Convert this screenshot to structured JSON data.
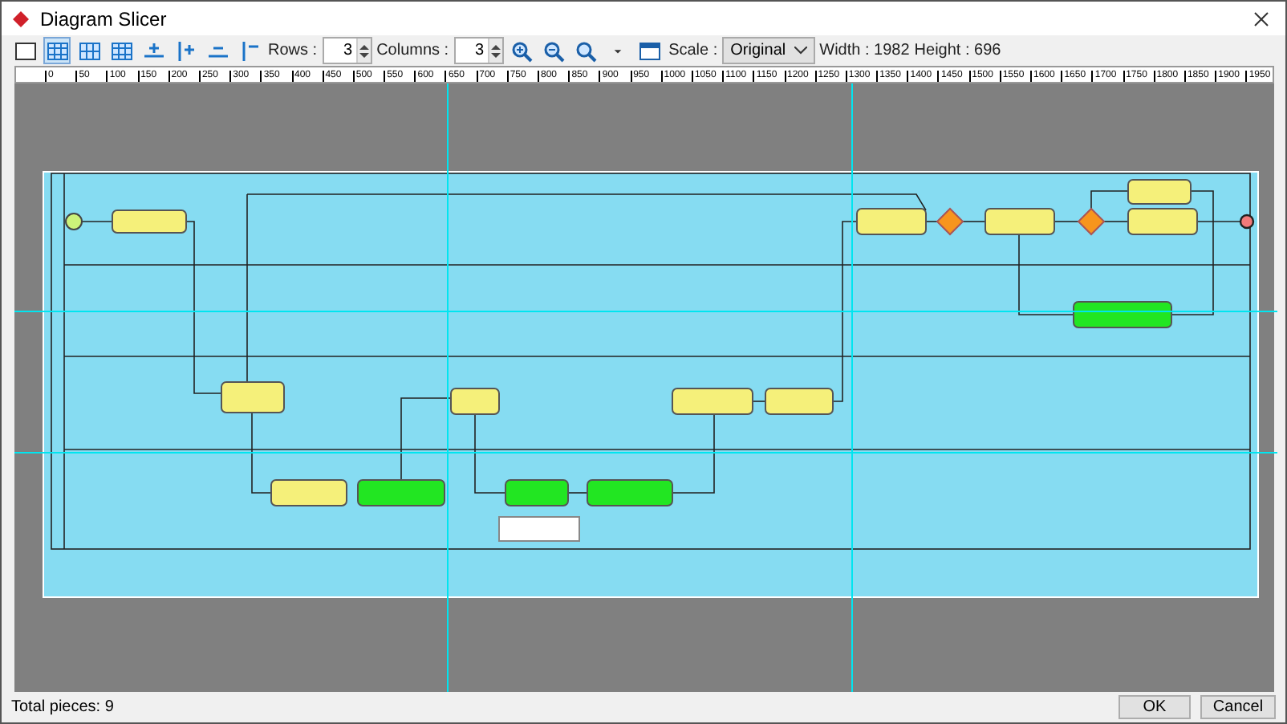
{
  "window": {
    "title": "Diagram Slicer"
  },
  "toolbar": {
    "layouts": [
      {
        "selected": false
      },
      {
        "selected": true
      },
      {
        "selected": false
      },
      {
        "selected": false
      }
    ],
    "rows": {
      "label": "Rows :",
      "value": "3"
    },
    "columns": {
      "label": "Columns :",
      "value": "3"
    },
    "scale": {
      "label": "Scale :",
      "value": "Original"
    },
    "width": "Width : 1982",
    "height": "Height : 696"
  },
  "ruler_labels": [
    "0",
    "50",
    "100",
    "150",
    "200",
    "250",
    "300",
    "350",
    "400",
    "450",
    "500",
    "550",
    "600",
    "650",
    "700",
    "750",
    "800",
    "850",
    "900",
    "950",
    "1000",
    "1050",
    "1100",
    "1150",
    "1200",
    "1250",
    "1300",
    "1350",
    "1400",
    "1450",
    "1500",
    "1550",
    "1600",
    "1650",
    "1700",
    "1750",
    "1800",
    "1850",
    "1900",
    "1950"
  ],
  "status": "Total pieces: 9",
  "buttons": [
    "OK",
    "Cancel"
  ]
}
